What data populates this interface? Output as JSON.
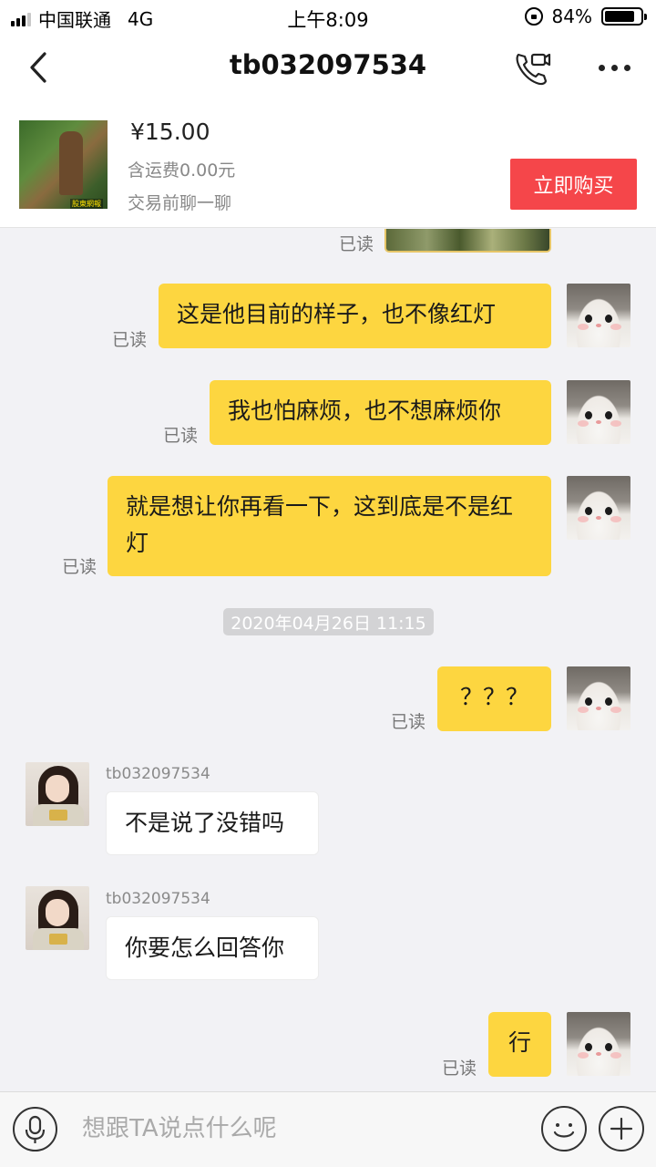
{
  "status_bar": {
    "carrier": "中国联通",
    "network": "4G",
    "time": "上午8:09",
    "battery": "84%",
    "battery_level": 0.84
  },
  "header": {
    "title": "tb032097534",
    "icons": [
      "back-icon",
      "video-call-icon",
      "more-icon"
    ]
  },
  "product": {
    "price": "¥15.00",
    "shipping": "含运费0.00元",
    "note": "交易前聊一聊",
    "buy_label": "立即购买",
    "thumb_badge": "股東網報"
  },
  "chat": {
    "read_label": "已读",
    "messages": [
      {
        "direction": "out",
        "type": "image"
      },
      {
        "direction": "out",
        "text": "这是他目前的样子，也不像红灯"
      },
      {
        "direction": "out",
        "text": "我也怕麻烦，也不想麻烦你"
      },
      {
        "direction": "out",
        "text": "就是想让你再看一下，这到底是不是红灯"
      },
      {
        "direction": "out",
        "text": "？？？"
      },
      {
        "direction": "in",
        "sender": "tb032097534",
        "text": "不是说了没错吗"
      },
      {
        "direction": "in",
        "sender": "tb032097534",
        "text": "你要怎么回答你"
      },
      {
        "direction": "out",
        "text": "行"
      }
    ],
    "timestamp": "2020年04月26日 11:15"
  },
  "input_bar": {
    "placeholder": "想跟TA说点什么呢",
    "icons": [
      "microphone-icon",
      "emoji-icon",
      "plus-icon"
    ]
  },
  "colors": {
    "outgoing_bubble": "#fdd640",
    "buy_button": "#f5464a"
  }
}
